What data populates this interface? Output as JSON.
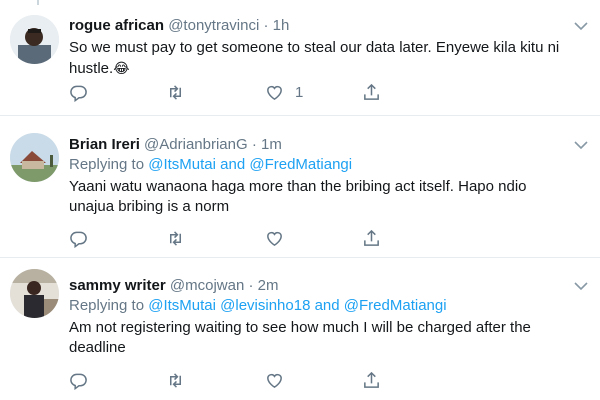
{
  "tweets": [
    {
      "display_name": "rogue african",
      "handle": "@tonytravinci",
      "separator": "·",
      "time": "1h",
      "text": "So we must pay to get someone to steal our data later. Enyewe kila kitu ni hustle.",
      "emoji": "😂",
      "like_count": "1"
    },
    {
      "display_name": "Brian Ireri",
      "handle": "@AdrianbrianG",
      "separator": "·",
      "time": "1m",
      "replying_prefix": "Replying to",
      "mentions": [
        "@ItsMutai",
        "@FredMatiangi"
      ],
      "conjunction": "and",
      "text": "Yaani watu wanaona haga more than the bribing act itself. Hapo ndio unajua bribing is a norm"
    },
    {
      "display_name": "sammy writer",
      "handle": "@mcojwan",
      "separator": "·",
      "time": "2m",
      "replying_prefix": "Replying to",
      "mentions": [
        "@ItsMutai",
        "@levisinho18",
        "@FredMatiangi"
      ],
      "conjunction": "and",
      "text": "Am not registering waiting to see how much I will be charged after the deadline"
    }
  ],
  "colors": {
    "link": "#1da1f2",
    "secondary_text": "#657786",
    "primary_text": "#14171a",
    "divider": "#e6ecf0"
  },
  "icons": [
    "reply-icon",
    "retweet-icon",
    "like-icon",
    "share-icon",
    "caret-down-icon"
  ]
}
